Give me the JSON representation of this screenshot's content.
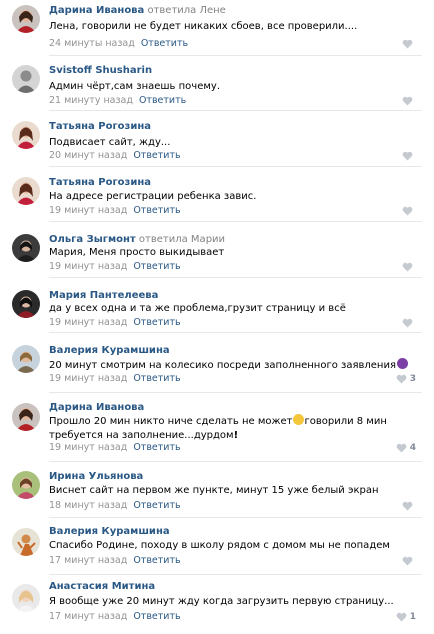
{
  "comments": [
    {
      "author": "Дарина Иванова",
      "reply": "ответила Лене",
      "text": "Лена, говорили не будет никаких сбоев, все проверили....",
      "time": "24 минуты назад",
      "reply_label": "Ответить",
      "likes": ""
    },
    {
      "author": "Svistoff Shusharin",
      "reply": "",
      "text": "Админ чёрт,сам знаешь почему.",
      "time": "21 минуту назад",
      "reply_label": "Ответить",
      "likes": ""
    },
    {
      "author": "Татьяна Рогозина",
      "reply": "",
      "text": "Подвисает сайт, жду...",
      "time": "20 минут назад",
      "reply_label": "Ответить",
      "likes": ""
    },
    {
      "author": "Татьяна Рогозина",
      "reply": "",
      "text": "На адресе регистрации ребенка завис.",
      "time": "19 минут назад",
      "reply_label": "Ответить",
      "likes": ""
    },
    {
      "author": "Ольга Зыгмонт",
      "reply": "ответила Марии",
      "text": "Мария, Меня просто выкидывает",
      "time": "19 минут назад",
      "reply_label": "Ответить",
      "likes": ""
    },
    {
      "author": "Мария Пантелеева",
      "reply": "",
      "text": "да у всех одна и та же проблема,грузит страницу и всё",
      "time": "19 минут назад",
      "reply_label": "Ответить",
      "likes": ""
    },
    {
      "author": "Валерия Курамшина",
      "reply": "",
      "text": "20 минут смотрим на колесико посреди заполненного заявления",
      "time": "19 минут назад",
      "reply_label": "Ответить",
      "likes": "3"
    },
    {
      "author": "Дарина Иванова",
      "reply": "",
      "text": "Прошло 20 мин никто ниче сделать не может",
      "text_after": "говорили 8 мин требуется на заполнение...дурдом",
      "text_end": "!",
      "time": "19 минут назад",
      "reply_label": "Ответить",
      "likes": "4"
    },
    {
      "author": "Ирина Ульянова",
      "reply": "",
      "text": "Виснет сайт на первом же пункте, минут 15 уже белый экран",
      "time": "18 минут назад",
      "reply_label": "Ответить",
      "likes": ""
    },
    {
      "author": "Валерия Курамшина",
      "reply": "",
      "text": "Спасибо Родине, походу в школу рядом с домом мы не попадем",
      "time": "17 минут назад",
      "reply_label": "Ответить",
      "likes": ""
    },
    {
      "author": "Анастасия Митина",
      "reply": "",
      "text": "Я вообще уже 20 минут жду когда загрузить первую страницу...",
      "time": "17 минут назад",
      "reply_label": "Ответить",
      "likes": "1"
    }
  ],
  "icons": {
    "like": "heart-icon",
    "emoji_devil": "devil-emoji-icon",
    "emoji_laugh": "laughing-emoji-icon",
    "emoji_exclaim": "exclamation-emoji-icon"
  },
  "colors": {
    "author": "#2a5885",
    "meta": "#939393",
    "like": "#828a99",
    "divider": "#e7e8ec"
  }
}
